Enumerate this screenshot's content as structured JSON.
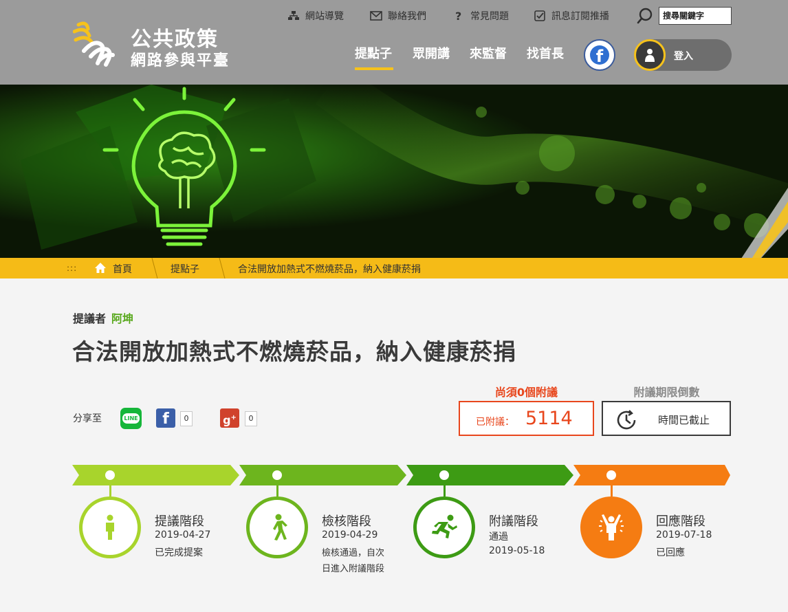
{
  "header": {
    "logo_title": "公共政策",
    "logo_subtitle": "網路參與平臺",
    "utilities": [
      {
        "label": "網站導覽",
        "icon": "sitemap-icon"
      },
      {
        "label": "聯絡我們",
        "icon": "mail-icon"
      },
      {
        "label": "常見問題",
        "icon": "question-icon"
      },
      {
        "label": "訊息訂閱推播",
        "icon": "checkbox-icon"
      }
    ],
    "search_placeholder": "搜尋關鍵字",
    "nav": [
      "提點子",
      "眾開講",
      "來監督",
      "找首長"
    ],
    "active_nav": "提點子",
    "login_label": "登入",
    "accent_color": "#f6c21c"
  },
  "breadcrumb": {
    "dots": ":::",
    "items": [
      "首頁",
      "提點子",
      "合法開放加熱式不燃燒菸品，納入健康菸捐"
    ]
  },
  "proposal": {
    "proposer_label": "提議者",
    "proposer_name": "阿坤",
    "title": "合法開放加熱式不燃燒菸品，納入健康菸捐"
  },
  "share": {
    "label": "分享至",
    "line_icon_text": "LINE",
    "facebook_count": "0",
    "googleplus_count": "0"
  },
  "endorse": {
    "need_label": "尚須0個附議",
    "attached_label": "已附議：",
    "attached_count": "5114",
    "countdown_label": "附議期限倒數",
    "countdown_status": "時間已截止",
    "accent_color": "#e8461c"
  },
  "stages": [
    {
      "title": "提議階段",
      "line1": "2019-04-27",
      "line2": "已完成提案",
      "line3": "",
      "color": "#a8d42c",
      "icon": "standing-person-icon"
    },
    {
      "title": "檢核階段",
      "line1": "2019-04-29",
      "line2": "檢核通過，自次",
      "line3": "日進入附議階段",
      "color": "#6db51e",
      "icon": "walking-person-icon"
    },
    {
      "title": "附議階段",
      "line1": "通過",
      "line2": "2019-05-18",
      "line3": "",
      "color": "#3d9b14",
      "icon": "running-person-icon"
    },
    {
      "title": "回應階段",
      "line1": "2019-07-18",
      "line2": "已回應",
      "line3": "",
      "color": "#f57c12",
      "icon": "cheering-person-icon"
    }
  ]
}
